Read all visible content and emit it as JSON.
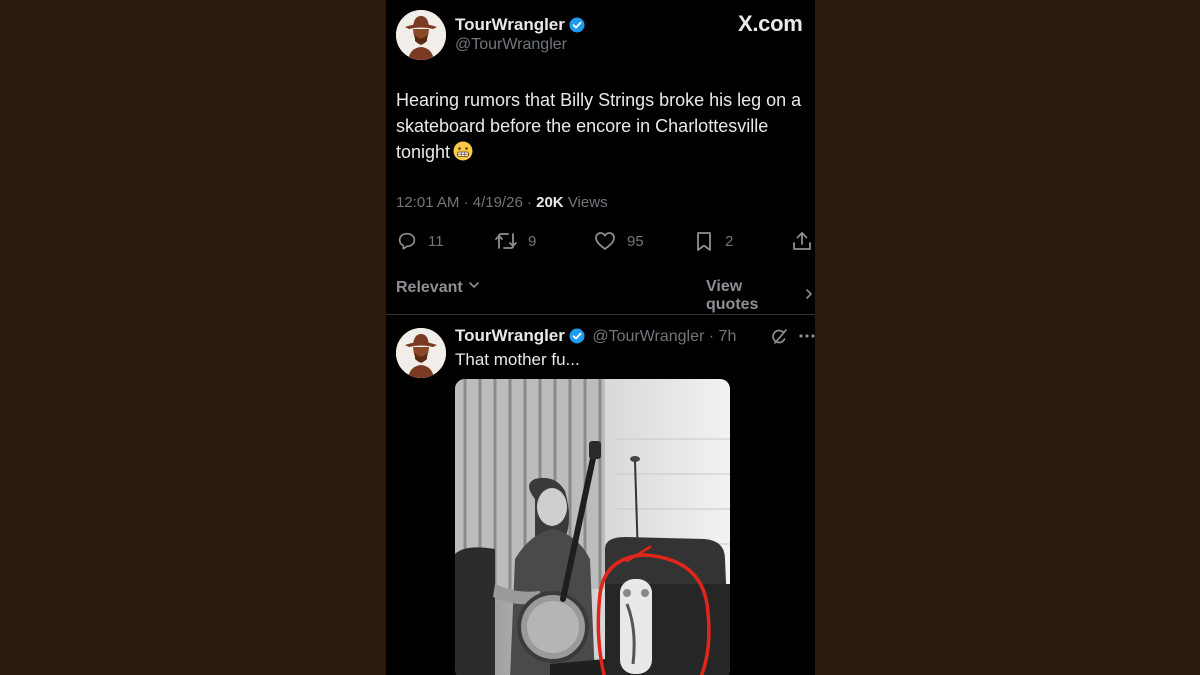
{
  "brand": "X.com",
  "colors": {
    "background": "#2d1a0f",
    "verified": "#1d9bf0",
    "annotation": "#e0261b"
  },
  "tweet": {
    "author_name": "TourWrangler",
    "author_handle": "@TourWrangler",
    "text": "Hearing rumors that Billy Strings broke his leg on a skateboard before the encore in Charlottesville tonight",
    "emoji": "grimacing-face",
    "time": "12:01 AM",
    "date": "4/19/26",
    "views_count": "20K",
    "views_label": "Views",
    "stats": {
      "replies": "11",
      "reposts": "9",
      "likes": "95",
      "bookmarks": "2"
    }
  },
  "filters": {
    "sort_label": "Relevant",
    "quotes_label": "View quotes"
  },
  "reply": {
    "author_name": "TourWrangler",
    "author_handle": "@TourWrangler",
    "age": "7h",
    "text": "That mother fu...",
    "photo_description_icons": [
      "banjo",
      "skateboard",
      "red-circle-annotation"
    ]
  },
  "icons": [
    "reply-icon",
    "repost-icon",
    "like-icon",
    "bookmark-icon",
    "share-icon",
    "chevron-down-icon",
    "chevron-right-icon",
    "grok-icon",
    "more-icon",
    "verified-icon"
  ]
}
